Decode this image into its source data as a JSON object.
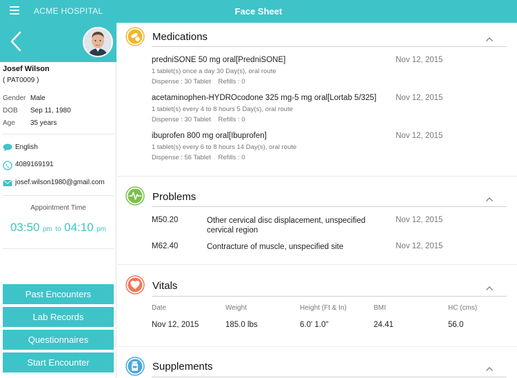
{
  "header": {
    "brand": "ACME HOSPITAL",
    "title": "Face Sheet"
  },
  "patient": {
    "name": "Josef Wilson",
    "id": "( PAT0009 )",
    "gender_label": "Gender",
    "gender": "Male",
    "dob_label": "DOB",
    "dob": "Sep 11, 1980",
    "age_label": "Age",
    "age": "35 years",
    "language": "English",
    "phone": "4089169191",
    "email": "josef.wilson1980@gmail.com"
  },
  "appointment": {
    "label": "Appointment Time",
    "start": "03:50",
    "start_suffix": "pm",
    "to": "to",
    "end": "04:10",
    "end_suffix": "pm"
  },
  "sidebar_buttons": {
    "past": "Past Encounters",
    "lab": "Lab Records",
    "questionnaires": "Questionnaires",
    "start": "Start Encounter"
  },
  "medications": {
    "title": "Medications",
    "items": [
      {
        "name": "predniSONE 50 mg oral[PredniSONE]",
        "instructions": "1 tablet(s) once a day 30 Day(s), oral route",
        "dispense": "Dispense : 30 Tablet    Refills : 0",
        "date": "Nov 12, 2015"
      },
      {
        "name": "acetaminophen-HYDROcodone 325 mg-5 mg oral[Lortab 5/325]",
        "instructions": "1 tablet(s) every 4 to 8 hours 5 Day(s), oral route",
        "dispense": "Dispense : 30 Tablet    Refills : 0",
        "date": "Nov 12, 2015"
      },
      {
        "name": "ibuprofen 800 mg oral[Ibuprofen]",
        "instructions": "1 tablet(s) every 6 to 8 hours 14 Day(s), oral route",
        "dispense": "Dispense : 56 Tablet    Refills : 0",
        "date": "Nov 12, 2015"
      }
    ]
  },
  "problems": {
    "title": "Problems",
    "items": [
      {
        "code": "M50.20",
        "description": "Other cervical disc displacement, unspecified cervical region",
        "date": "Nov 12, 2015"
      },
      {
        "code": "M62.40",
        "description": "Contracture of muscle, unspecified site",
        "date": "Nov 12, 2015"
      }
    ]
  },
  "vitals": {
    "title": "Vitals",
    "headers": [
      "Date",
      "Weight",
      "Height (Ft & In)",
      "BMI",
      "HC (cms)"
    ],
    "row": [
      "Nov 12, 2015",
      "185.0 lbs",
      "6.0' 1.0\"",
      "24.41",
      "56.0"
    ]
  },
  "supplements": {
    "title": "Supplements"
  },
  "colors": {
    "accent": "#3ec3c9",
    "medications_icon": "#f5b52e",
    "problems_icon": "#7cc04b",
    "vitals_icon": "#f0785a",
    "supplements_icon": "#4aa8e0"
  },
  "icons": {
    "menu": "hamburger-menu-icon",
    "back": "chevron-left-icon",
    "language": "speech-bubble-icon",
    "phone": "phone-icon",
    "email": "envelope-icon",
    "medications": "pills-icon",
    "problems": "heartbeat-icon",
    "vitals": "heart-icon",
    "supplements": "bottle-icon",
    "collapse": "chevron-up-icon"
  }
}
